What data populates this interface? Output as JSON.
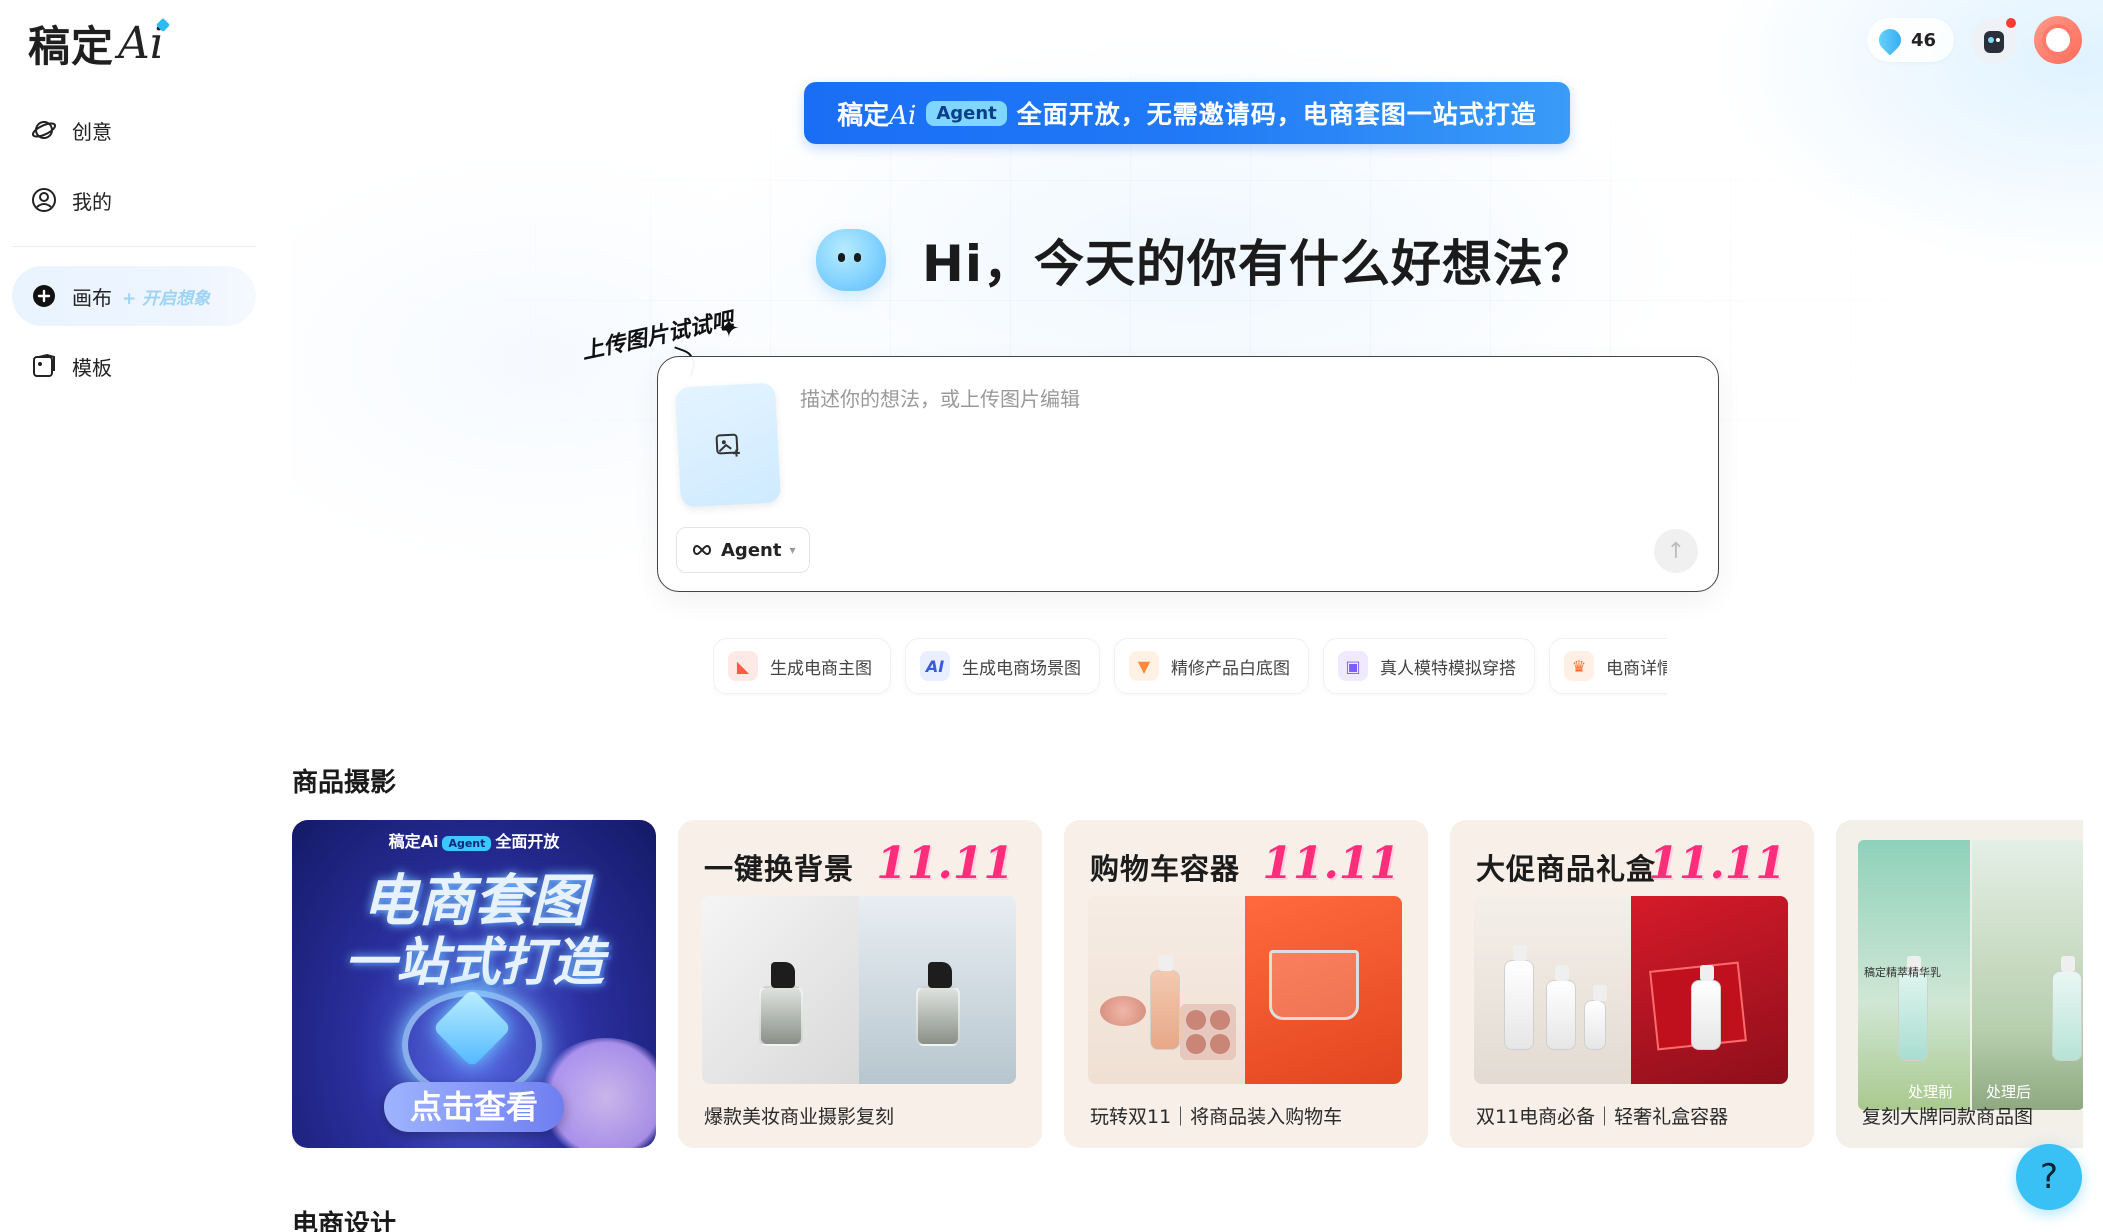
{
  "app": {
    "logo_text": "稿定",
    "logo_ai": "Ai"
  },
  "sidebar": {
    "items": [
      {
        "label": "创意",
        "icon": "planet-icon"
      },
      {
        "label": "我的",
        "icon": "user-circle-icon"
      },
      {
        "label": "画布",
        "hint": "+ 开启想象",
        "icon": "plus-circle-icon",
        "active": true
      },
      {
        "label": "模板",
        "icon": "template-icon"
      }
    ]
  },
  "topbar": {
    "credits": "46"
  },
  "banner": {
    "logo": "稿定",
    "logo_ai": "Ai",
    "badge": "Agent",
    "text": "全面开放，无需邀请码，电商套图一站式打造"
  },
  "hero": {
    "title": "Hi，今天的你有什么好想法？"
  },
  "prompt": {
    "upload_hint": "上传图片试试吧",
    "placeholder": "描述你的想法，或上传图片编辑",
    "value": "",
    "mode_label": "Agent"
  },
  "chips": [
    {
      "label": "生成电商主图",
      "icon": "shoe-icon",
      "color": "#ff6b6b"
    },
    {
      "label": "生成电商场景图",
      "icon": "ai-icon",
      "color": "#3a5bd9"
    },
    {
      "label": "精修产品白底图",
      "icon": "fox-icon",
      "color": "#ff8a3d"
    },
    {
      "label": "真人模特模拟穿搭",
      "icon": "model-icon",
      "color": "#7a5cff"
    },
    {
      "label": "电商详情",
      "icon": "trophy-icon",
      "color": "#ff6a2a"
    }
  ],
  "sections": {
    "product_photo": "商品摄影",
    "ecommerce_design": "电商设计"
  },
  "cards": [
    {
      "type": "promo",
      "head_logo": "稿定Ai",
      "head_badge": "Agent",
      "head_text": "全面开放",
      "line1": "电商套图",
      "line2": "一站式打造",
      "button": "点击查看"
    },
    {
      "title": "一键换背景",
      "badge": "11.11",
      "caption": "爆款美妆商业摄影复刻"
    },
    {
      "title": "购物车容器",
      "badge": "11.11",
      "caption": "玩转双11｜将商品装入购物车"
    },
    {
      "title": "大促商品礼盒",
      "badge": "11.11",
      "caption": "双11电商必备｜轻奢礼盒容器"
    },
    {
      "caption": "复刻大牌同款商品图",
      "before": "处理前",
      "after": "处理后",
      "product_label": "稿定精萃精华乳"
    }
  ],
  "help": {
    "label": "?"
  },
  "colors": {
    "accent": "#1a6ef5",
    "badge_pink": "#ff2d7a",
    "help": "#39c0f5"
  }
}
